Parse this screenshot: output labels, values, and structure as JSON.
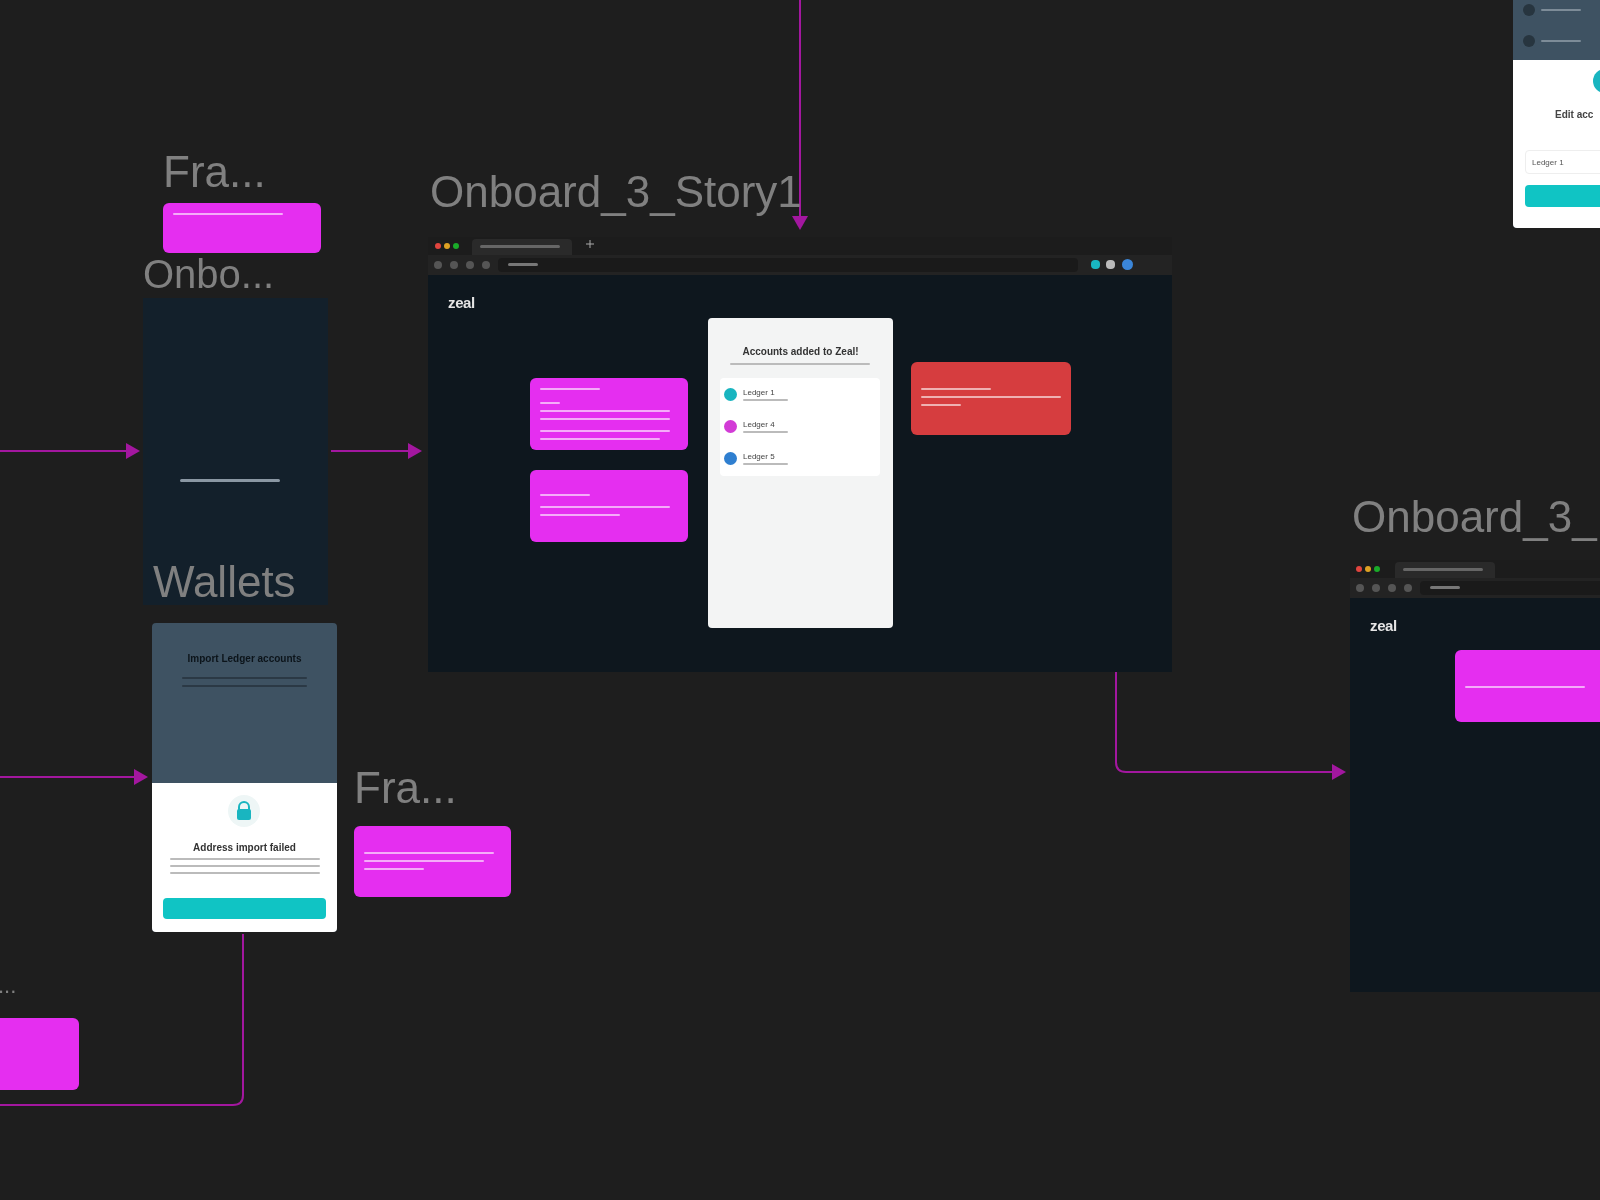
{
  "labels": [
    "Fra...",
    "Onbo...",
    "Onboard_3_Story1",
    "Wallets",
    "Fra...",
    "Onboard_3_",
    "..."
  ],
  "stickies": [
    {
      "color": "#e52ef0"
    },
    {
      "color": "#e52ef0"
    },
    {
      "color": "#e52ef0"
    },
    {
      "color": "#d63d3f"
    },
    {
      "color": "#e52ef0"
    },
    {
      "color": "#e52ef0"
    },
    {
      "color": "#e52ef0"
    }
  ],
  "logos": [
    "zeal",
    "zeal"
  ],
  "main_card": {
    "title": "Accounts added to Zeal!",
    "accounts": [
      {
        "name": "Ledger 1",
        "color": "#19b5c0"
      },
      {
        "name": "Ledger 4",
        "color": "#d23bd6"
      },
      {
        "name": "Ledger 5",
        "color": "#2f7fd0"
      }
    ]
  },
  "wallets_modal": {
    "background_title": "Import Ledger accounts",
    "title": "Address import failed"
  },
  "edit_modal": {
    "title": "Edit acc",
    "input_value": "Ledger 1"
  }
}
